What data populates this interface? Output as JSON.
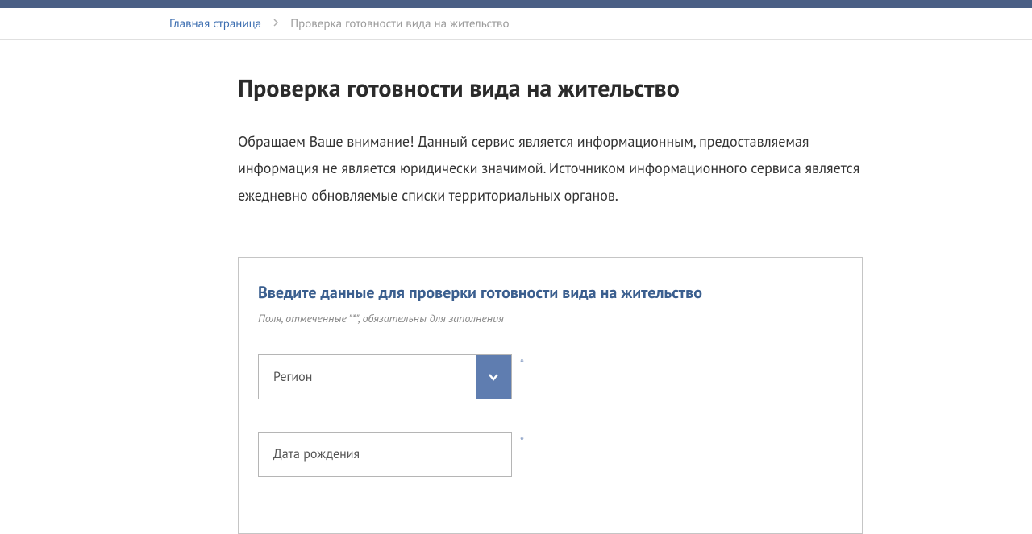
{
  "breadcrumb": {
    "home": "Главная страница",
    "current": "Проверка готовности вида на жительство"
  },
  "page": {
    "title": "Проверка готовности вида на жительство",
    "intro": "Обращаем Ваше внимание! Данный сервис является информационным, предоставляемая информация не является юридически значимой. Источником информационного сервиса является ежедневно обновляемые списки территориальных органов."
  },
  "form": {
    "title": "Введите данные для проверки готовности вида на жительство",
    "hint": "Поля, отмеченные \"*\", обязательны для заполнения",
    "region": {
      "label": "Регион",
      "required": "*"
    },
    "birthdate": {
      "placeholder": "Дата рождения",
      "required": "*"
    }
  }
}
